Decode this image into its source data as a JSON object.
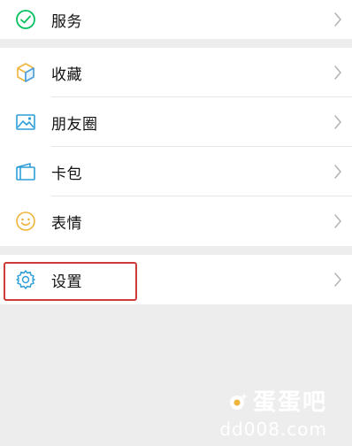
{
  "menu": {
    "top": {
      "label": "服务",
      "icon": "services-icon"
    },
    "middle": [
      {
        "label": "收藏",
        "icon": "favorites-cube-icon"
      },
      {
        "label": "朋友圈",
        "icon": "moments-image-icon"
      },
      {
        "label": "卡包",
        "icon": "card-wallet-icon"
      },
      {
        "label": "表情",
        "icon": "smiley-icon"
      }
    ],
    "bottom": {
      "label": "设置",
      "icon": "gear-icon"
    }
  },
  "chevron_icon": "chevron-right-icon",
  "highlight_color": "#cd3b3b",
  "watermark": {
    "brand": "蛋蛋吧",
    "domain": "dd008.com",
    "logo_icon": "egg-logo-icon"
  }
}
